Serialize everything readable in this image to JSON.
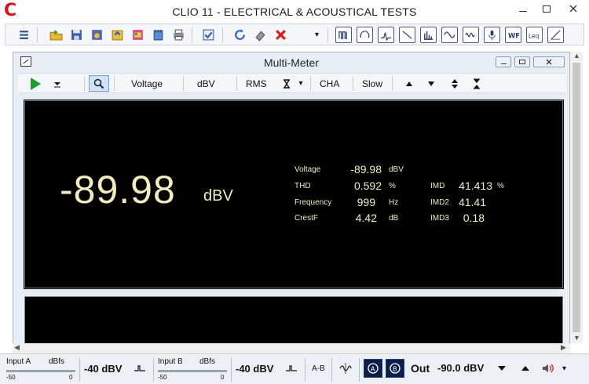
{
  "app": {
    "title": "CLIO 11 - ELECTRICAL & ACOUSTICAL TESTS",
    "logo_letter": "C"
  },
  "child": {
    "title": "Multi-Meter"
  },
  "childtoolbar": {
    "parameter": "Voltage",
    "unit": "dBV",
    "detector": "RMS",
    "channel": "CHA",
    "speed": "Slow"
  },
  "reading": {
    "value": "-89.98",
    "unit": "dBV"
  },
  "measurements": [
    {
      "label": "Voltage",
      "value": "-89.98",
      "unit": "dBV"
    },
    {
      "label": "THD",
      "value": "0.592",
      "unit": "%"
    },
    {
      "label": "Frequency",
      "value": "999",
      "unit": "Hz"
    },
    {
      "label": "CrestF",
      "value": "4.42",
      "unit": "dB"
    }
  ],
  "imd": [
    {
      "label": "IMD",
      "value": "41.413",
      "unit": "%"
    },
    {
      "label": "IMD2",
      "value": "41.41",
      "unit": ""
    },
    {
      "label": "IMD3",
      "value": "0.18",
      "unit": ""
    }
  ],
  "status": {
    "input_a": {
      "label": "Input A",
      "scale_unit": "dBfs",
      "min": "-50",
      "max": "0",
      "level": "-40 dBV"
    },
    "input_b": {
      "label": "Input B",
      "scale_unit": "dBfs",
      "min": "-50",
      "max": "0",
      "level": "-40 dBV"
    },
    "ab_label": "A-B",
    "out_label": "Out",
    "out_level": "-90.0 dBV"
  },
  "colors": {
    "display_bg": "#000000",
    "display_text": "#f2ecbe",
    "logo": "#d8141c",
    "play_green": "#1f9a2c"
  }
}
